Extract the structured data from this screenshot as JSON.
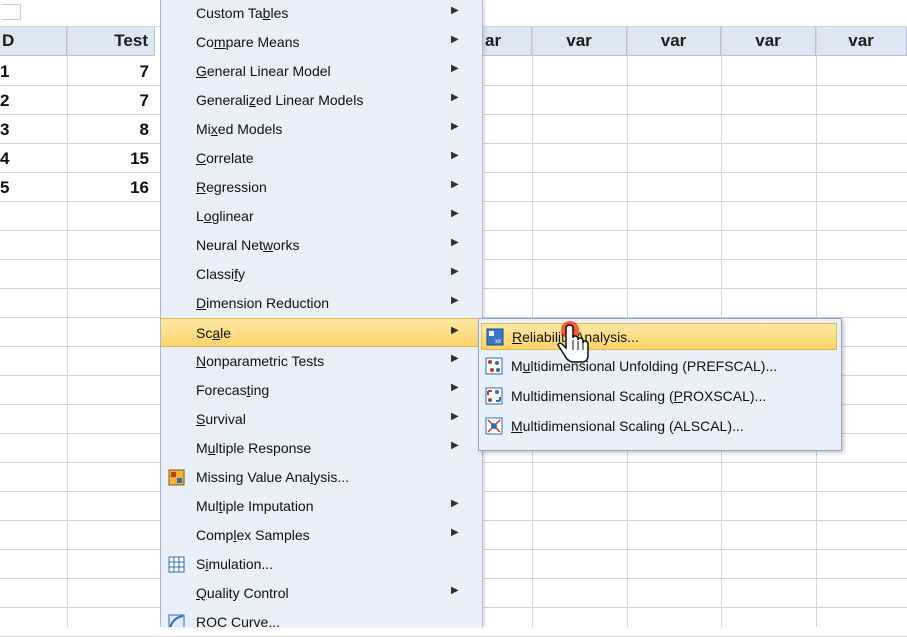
{
  "grid": {
    "columns": [
      "D",
      "Test",
      "ar",
      "var",
      "var",
      "var",
      "var"
    ],
    "row_numbers": [
      "1",
      "2",
      "3",
      "4",
      "5"
    ],
    "test_values": [
      "7",
      "7",
      "8",
      "15",
      "16"
    ]
  },
  "menu": {
    "items": [
      {
        "pre": "Custom Ta",
        "key": "b",
        "post": "les",
        "submenu": true
      },
      {
        "pre": "Co",
        "key": "m",
        "post": "pare Means",
        "submenu": true
      },
      {
        "pre": "",
        "key": "G",
        "post": "eneral Linear Model",
        "submenu": true
      },
      {
        "pre": "Generali",
        "key": "z",
        "post": "ed Linear Models",
        "submenu": true
      },
      {
        "pre": "Mi",
        "key": "x",
        "post": "ed Models",
        "submenu": true
      },
      {
        "pre": "",
        "key": "C",
        "post": "orrelate",
        "submenu": true
      },
      {
        "pre": "",
        "key": "R",
        "post": "egression",
        "submenu": true
      },
      {
        "pre": "L",
        "key": "o",
        "post": "glinear",
        "submenu": true
      },
      {
        "pre": "Neural Net",
        "key": "w",
        "post": "orks",
        "submenu": true
      },
      {
        "pre": "Classi",
        "key": "f",
        "post": "y",
        "submenu": true
      },
      {
        "pre": "",
        "key": "D",
        "post": "imension Reduction",
        "submenu": true
      },
      {
        "pre": "Sc",
        "key": "a",
        "post": "le",
        "submenu": true,
        "highlighted": true
      },
      {
        "pre": "",
        "key": "N",
        "post": "onparametric Tests",
        "submenu": true
      },
      {
        "pre": "Forecas",
        "key": "t",
        "post": "ing",
        "submenu": true
      },
      {
        "pre": "",
        "key": "S",
        "post": "urvival",
        "submenu": true
      },
      {
        "pre": "M",
        "key": "u",
        "post": "ltiple Response",
        "submenu": true
      },
      {
        "pre": "Missing Value Ana",
        "key": "l",
        "post": "ysis...",
        "submenu": false,
        "icon": "missing-value-icon"
      },
      {
        "pre": "Mul",
        "key": "t",
        "post": "iple Imputation",
        "submenu": true
      },
      {
        "pre": "Comp",
        "key": "l",
        "post": "ex Samples",
        "submenu": true
      },
      {
        "pre": "S",
        "key": "i",
        "post": "mulation...",
        "submenu": false,
        "icon": "simulation-icon"
      },
      {
        "pre": "",
        "key": "Q",
        "post": "uality Control",
        "submenu": true
      },
      {
        "pre": "",
        "key": "",
        "post": "ROC Curve...",
        "submenu": false,
        "icon": "roc-curve-icon"
      }
    ]
  },
  "submenu": {
    "items": [
      {
        "pre": "",
        "key": "R",
        "post": "eliability Analysis...",
        "icon": "reliability-icon",
        "highlighted": true
      },
      {
        "pre": "M",
        "key": "u",
        "post": "ltidimensional Unfolding (PREFSCAL)...",
        "icon": "prefscal-icon"
      },
      {
        "pre": "Multidimensional Scaling (",
        "key": "P",
        "post": "ROXSCAL)...",
        "icon": "proxscal-icon"
      },
      {
        "pre": "",
        "key": "M",
        "post": "ultidimensional Scaling (ALSCAL)...",
        "icon": "alscal-icon"
      }
    ]
  },
  "colors": {
    "menu_bg": "#eaf0f9",
    "highlight": "#fbd46a",
    "header_bg": "#dde6f3"
  }
}
